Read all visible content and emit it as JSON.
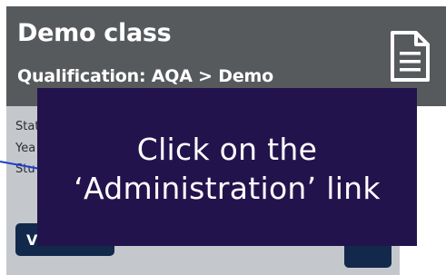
{
  "card": {
    "title": "Demo class",
    "subtitle": "Qualification: AQA > Demo",
    "icon": "document-icon",
    "fields": [
      "Stat",
      "Yea",
      "Stu"
    ],
    "view_button_label": "Vi",
    "colors": {
      "header_bg": "#575a5d",
      "card_bg": "#c4c8cd",
      "button_bg": "#13294b"
    }
  },
  "tooltip": {
    "line1": "Click on the",
    "line2": "‘Administration’ link",
    "bg_color": "#23134d"
  },
  "pointer": {
    "color": "#1a3fd0"
  }
}
